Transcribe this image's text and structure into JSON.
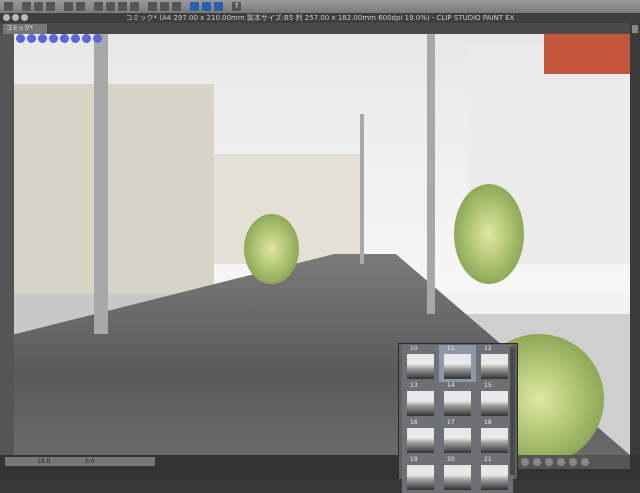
{
  "title": "コミック* (A4 297.00 x 210.00mm 製本サイズ:B5 判 257.00 x 182.00mm 600dpi 19.0%) - CLIP STUDIO PAINT EX",
  "tab": "コミック*",
  "status": {
    "zoom": "19.0",
    "angle": "0.0"
  },
  "pages": [
    "10",
    "11",
    "12",
    "13",
    "14",
    "15",
    "16",
    "17",
    "18",
    "19",
    "20",
    "21"
  ],
  "selected_page": "11",
  "toolbar_icons": [
    "app-icon",
    "new-icon",
    "open-icon",
    "save-icon",
    "undo-icon",
    "redo-icon",
    "transform-icon",
    "clear-icon",
    "fill-icon",
    "ruler-icon",
    "help-icon"
  ]
}
